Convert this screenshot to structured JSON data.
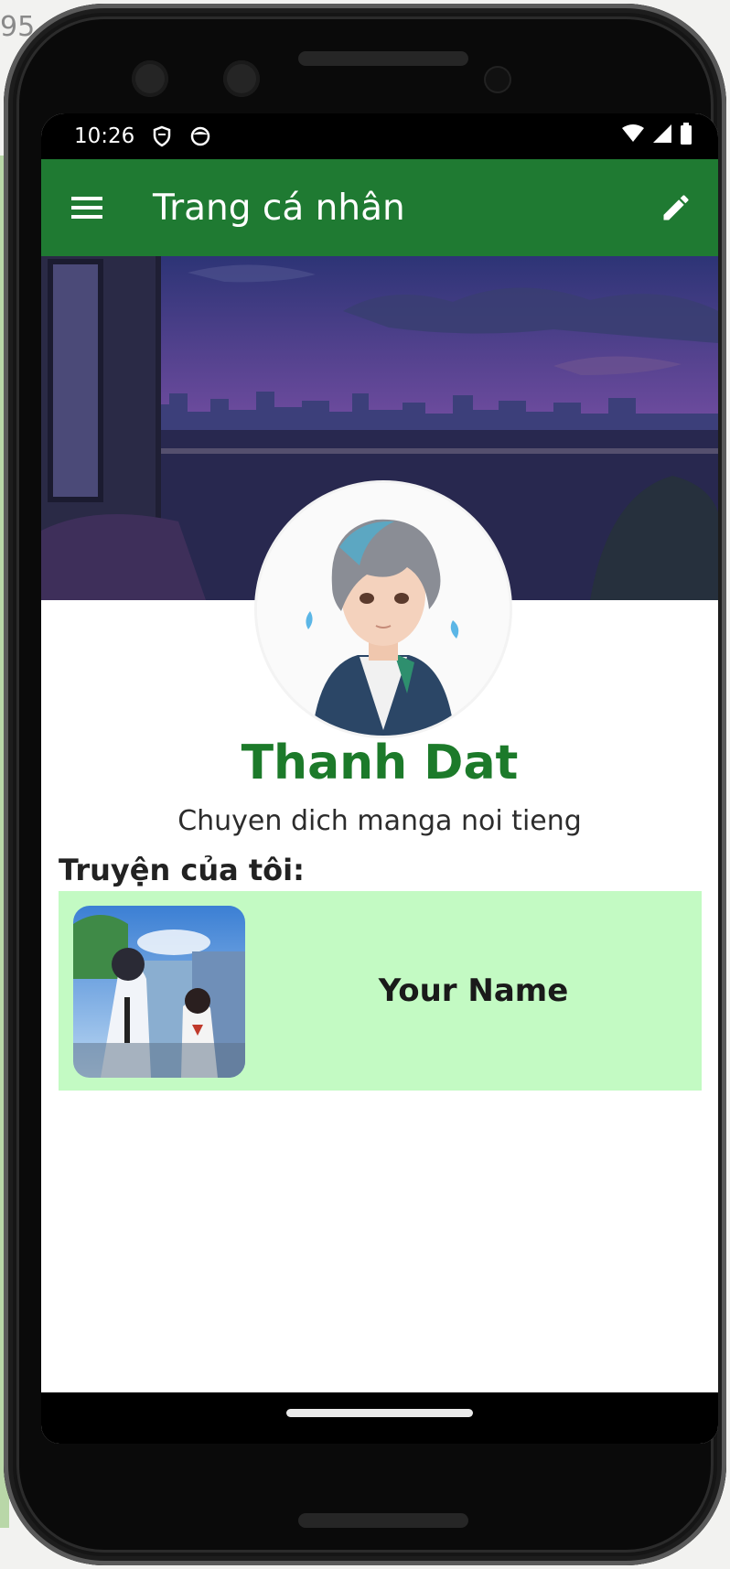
{
  "status_bar": {
    "time": "10:26",
    "icons": [
      "shield-icon",
      "face-icon",
      "wifi-icon",
      "signal-icon",
      "battery-icon"
    ]
  },
  "app_bar": {
    "title": "Trang cá nhân",
    "menu_icon": "hamburger-menu-icon",
    "edit_icon": "pencil-icon",
    "color": "#1f7a32"
  },
  "profile": {
    "name": "Thanh Dat",
    "bio": "Chuyen dich manga noi tieng",
    "name_color": "#1c7a2a"
  },
  "stories": {
    "section_title": "Truyện của tôi:",
    "card_color": "#c3fac3",
    "items": [
      {
        "title": "Your Name"
      }
    ]
  }
}
